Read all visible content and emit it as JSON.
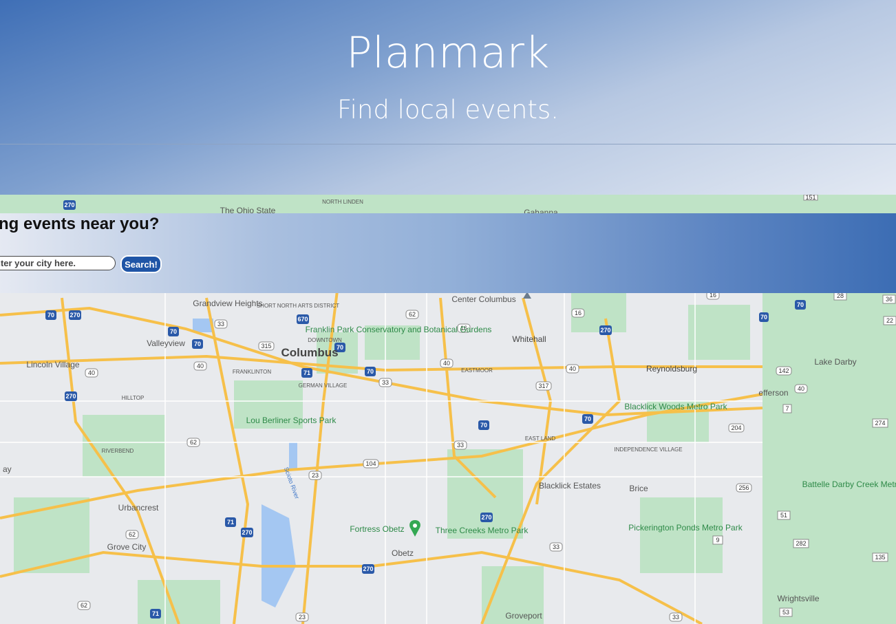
{
  "header": {
    "title": "Planmark",
    "tagline": "Find local events."
  },
  "search": {
    "question": "ng events near you?",
    "placeholder": "nter your city here.",
    "button_label": "Search!"
  },
  "map": {
    "places": [
      "The Ohio State",
      "NORTH LINDEN",
      "Gahanna",
      "Center Columbus",
      "Grandview Heights",
      "SHORT NORTH ARTS DISTRICT",
      "DOWNTOWN",
      "Columbus",
      "Franklin Park Conservatory and Botanical Gardens",
      "Whitehall",
      "Valleyview",
      "Lincoln Village",
      "FRANKLINTON",
      "GERMAN VILLAGE",
      "EASTMOOR",
      "Reynoldsburg",
      "Lake Darby",
      "efferson",
      "HILLTOP",
      "Blacklick Woods Metro Park",
      "Lou Berliner Sports Park",
      "EAST LAND",
      "INDEPENDENCE VILLAGE",
      "RIVERBEND",
      "Scioto River",
      "Blacklick Estates",
      "Brice",
      "Battelle Darby Creek Metro Park",
      "Urbancrest",
      "Fortress Obetz",
      "Three Creeks Metro Park",
      "Pickerington Ponds Metro Park",
      "Grove City",
      "Obetz",
      "Wrightsville",
      "Groveport",
      "ay"
    ],
    "shields": [
      "270",
      "70",
      "670",
      "315",
      "33",
      "62",
      "16",
      "40",
      "71",
      "317",
      "104",
      "23",
      "204",
      "256",
      "142",
      "7",
      "274",
      "22",
      "36",
      "28",
      "51",
      "282",
      "135",
      "53",
      "9",
      "3",
      "161",
      "151"
    ],
    "colors": {
      "land": "#e8eaed",
      "park": "#b9dfc1",
      "highway": "#f7c04a",
      "water": "#9ec2f0",
      "interstate": "#2a59a8"
    }
  }
}
